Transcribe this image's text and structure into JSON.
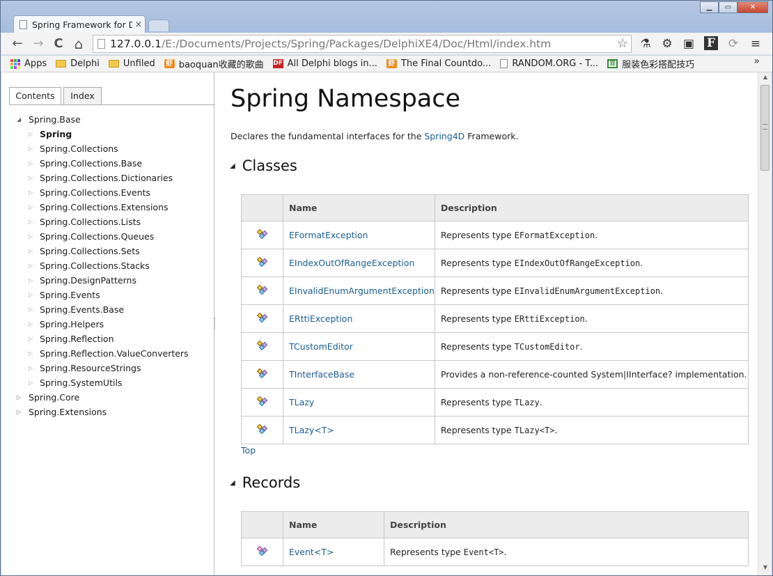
{
  "window": {
    "tab_title": "Spring Framework for D",
    "close_tab": "×",
    "minimize": "▁",
    "maximize": "▭",
    "close": "✕"
  },
  "toolbar": {
    "back_icon": "←",
    "forward_icon": "→",
    "reload_icon": "C",
    "home_icon": "⌂",
    "url_host": "127.0.0.1",
    "url_path": "/E:/Documents/Projects/Spring/Packages/DelphiXE4/Doc/Html/index.htm",
    "bookmark_star": "☆",
    "extensions": [
      "⚗",
      "⚙",
      "▣",
      "F",
      "⟳",
      "≡"
    ]
  },
  "bookmarks": {
    "items": [
      {
        "label": "Apps",
        "icon": "apps-icon"
      },
      {
        "label": "Delphi",
        "icon": "folder-icon"
      },
      {
        "label": "Unfiled",
        "icon": "folder-icon"
      },
      {
        "label": "baoquan收藏的歌曲",
        "icon": "xiami-icon",
        "glyph": "虾"
      },
      {
        "label": "All Delphi blogs in...",
        "icon": "df-icon",
        "glyph": "DF"
      },
      {
        "label": "The Final Countdo...",
        "icon": "xiami-icon",
        "glyph": "虾"
      },
      {
        "label": "RANDOM.ORG - T...",
        "icon": "page-icon"
      },
      {
        "label": "服装色彩搭配技巧",
        "icon": "green-icon",
        "glyph": "豆"
      }
    ],
    "more": "»"
  },
  "left_pane": {
    "tab_contents": "Contents",
    "tab_index": "Index",
    "tree": [
      {
        "label": "Spring.Base",
        "level": 0,
        "expanded": true
      },
      {
        "label": "Spring",
        "level": 1,
        "bold": true
      },
      {
        "label": "Spring.Collections",
        "level": 1
      },
      {
        "label": "Spring.Collections.Base",
        "level": 1
      },
      {
        "label": "Spring.Collections.Dictionaries",
        "level": 1
      },
      {
        "label": "Spring.Collections.Events",
        "level": 1
      },
      {
        "label": "Spring.Collections.Extensions",
        "level": 1
      },
      {
        "label": "Spring.Collections.Lists",
        "level": 1
      },
      {
        "label": "Spring.Collections.Queues",
        "level": 1
      },
      {
        "label": "Spring.Collections.Sets",
        "level": 1
      },
      {
        "label": "Spring.Collections.Stacks",
        "level": 1
      },
      {
        "label": "Spring.DesignPatterns",
        "level": 1
      },
      {
        "label": "Spring.Events",
        "level": 1
      },
      {
        "label": "Spring.Events.Base",
        "level": 1
      },
      {
        "label": "Spring.Helpers",
        "level": 1
      },
      {
        "label": "Spring.Reflection",
        "level": 1
      },
      {
        "label": "Spring.Reflection.ValueConverters",
        "level": 1
      },
      {
        "label": "Spring.ResourceStrings",
        "level": 1
      },
      {
        "label": "Spring.SystemUtils",
        "level": 1
      },
      {
        "label": "Spring.Core",
        "level": 0,
        "expanded": false
      },
      {
        "label": "Spring.Extensions",
        "level": 0,
        "expanded": false
      }
    ]
  },
  "main": {
    "title": "Spring Namespace",
    "desc_before": "Declares the fundamental interfaces for the ",
    "desc_link": "Spring4D",
    "desc_after": " Framework.",
    "classes_heading": "Classes",
    "col_name": "Name",
    "col_description": "Description",
    "classes": [
      {
        "name": "EFormatException",
        "desc_text": "Represents type ",
        "desc_code": "EFormatException",
        "desc_end": "."
      },
      {
        "name": "EIndexOutOfRangeException",
        "desc_text": "Represents type ",
        "desc_code": "EIndexOutOfRangeException",
        "desc_end": "."
      },
      {
        "name": "EInvalidEnumArgumentException",
        "desc_text": "Represents type ",
        "desc_code": "EInvalidEnumArgumentException",
        "desc_end": "."
      },
      {
        "name": "ERttiException",
        "desc_text": "Represents type ",
        "desc_code": "ERttiException",
        "desc_end": "."
      },
      {
        "name": "TCustomEditor",
        "desc_text": "Represents type ",
        "desc_code": "TCustomEditor",
        "desc_end": "."
      },
      {
        "name": "TInterfaceBase",
        "desc_text": "Provides a non-reference-counted System|IInterface? implementation.",
        "desc_code": "",
        "desc_end": ""
      },
      {
        "name": "TLazy",
        "desc_text": "Represents type ",
        "desc_code": "TLazy",
        "desc_end": "."
      },
      {
        "name": "TLazy<T>",
        "desc_text": "Represents type ",
        "desc_code": "TLazy<T>",
        "desc_end": "."
      }
    ],
    "top_link": "Top",
    "records_heading": "Records",
    "records": [
      {
        "name": "Event<T>",
        "desc_text": "Represents type ",
        "desc_code": "Event<T>",
        "desc_end": "."
      }
    ]
  }
}
